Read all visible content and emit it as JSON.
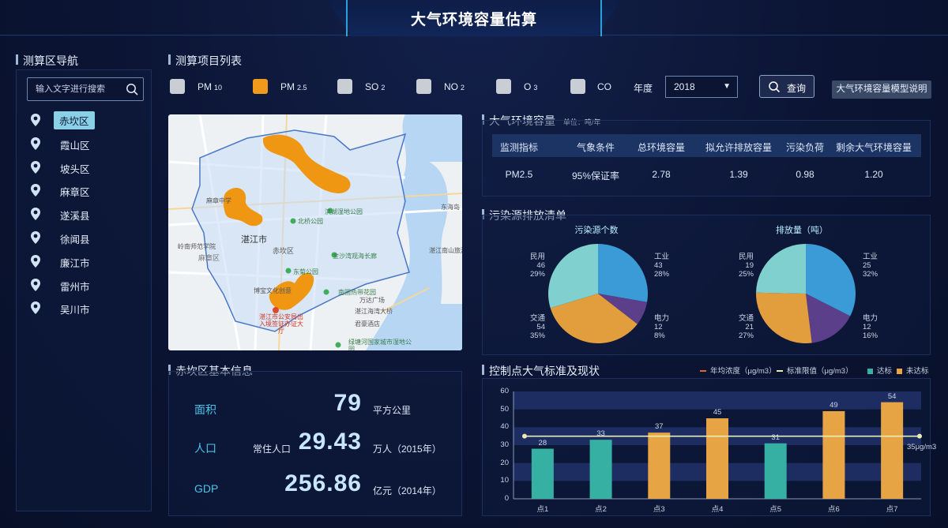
{
  "header": {
    "title": "大气环境容量估算"
  },
  "nav": {
    "title": "测算区导航",
    "search_placeholder": "输入文字进行搜索",
    "items": [
      {
        "label": "赤坎区",
        "active": true
      },
      {
        "label": "霞山区"
      },
      {
        "label": "坡头区"
      },
      {
        "label": "麻章区"
      },
      {
        "label": "遂溪县"
      },
      {
        "label": "徐闻县"
      },
      {
        "label": "廉江市"
      },
      {
        "label": "雷州市"
      },
      {
        "label": "吴川市"
      }
    ]
  },
  "project": {
    "title": "测算项目列表",
    "pollutants": [
      {
        "main": "PM",
        "sub": "10",
        "checked": false
      },
      {
        "main": "PM",
        "sub": "2.5",
        "checked": true
      },
      {
        "main": "SO",
        "sub": "2",
        "checked": false
      },
      {
        "main": "NO",
        "sub": "2",
        "checked": false
      },
      {
        "main": "O",
        "sub": "3",
        "checked": false
      },
      {
        "main": "CO",
        "sub": "",
        "checked": false
      }
    ],
    "year_label": "年度",
    "year_value": "2018",
    "query_label": "查询",
    "model_label": "大气环境容量模型说明"
  },
  "map": {
    "labels": {
      "city": "湛江市",
      "district": "赤坎区",
      "mazhang": "麻章区",
      "park1": "北桥公园",
      "park2": "滨湖湿地公园",
      "park3": "金沙湾观海长廊",
      "park4": "东菊公园",
      "park5": "南国热带花园",
      "mall": "万达广场",
      "bridge": "湛江海湾大桥",
      "hotel": "君豪酒店",
      "center": "湛江市公安局出入境签证办证大厅",
      "culture": "博宝文化创意",
      "green": "绿塘河国家城市湿地公园",
      "road1": "麻章中学",
      "road2": "岭南师范学院",
      "nanshan": "湛江南山旅游学校",
      "donghai": "东海岛"
    }
  },
  "capacity": {
    "title": "大气环境容量",
    "unit": "单位：吨/年",
    "headers": [
      "监测指标",
      "气象条件",
      "总环境容量",
      "拟允许排放容量",
      "污染负荷",
      "剩余大气环境容量"
    ],
    "row": [
      "PM2.5",
      "95%保证率",
      "2.78",
      "1.39",
      "0.98",
      "1.20"
    ]
  },
  "emission": {
    "title": "污染源排放清单",
    "pie1_title": "污染源个数",
    "pie2_title": "排放量（吨）",
    "pie1": [
      {
        "name": "工业",
        "value": 43,
        "pct": "28%",
        "color": "#3a9bd6"
      },
      {
        "name": "电力",
        "value": 12,
        "pct": "8%",
        "color": "#5b3f8a"
      },
      {
        "name": "交通",
        "value": 54,
        "pct": "35%",
        "color": "#e29e3c"
      },
      {
        "name": "民用",
        "value": 46,
        "pct": "29%",
        "color": "#7fd0cf"
      }
    ],
    "pie2": [
      {
        "name": "工业",
        "value": 25,
        "pct": "32%",
        "color": "#3a9bd6"
      },
      {
        "name": "电力",
        "value": 12,
        "pct": "16%",
        "color": "#5b3f8a"
      },
      {
        "name": "交通",
        "value": 21,
        "pct": "27%",
        "color": "#e29e3c"
      },
      {
        "name": "民用",
        "value": 19,
        "pct": "25%",
        "color": "#7fd0cf"
      }
    ]
  },
  "info": {
    "title": "赤坎区基本信息",
    "area_label": "面积",
    "area_value": "79",
    "area_unit": "平方公里",
    "pop_label": "人口",
    "pop_prefix": "常住人口",
    "pop_value": "29.43",
    "pop_unit": "万人（2015年）",
    "gdp_label": "GDP",
    "gdp_value": "256.86",
    "gdp_unit": "亿元（2014年）"
  },
  "control": {
    "title": "控制点大气标准及现状",
    "legend": [
      "年均浓度（μg/m3）",
      "标准限值（μg/m3）",
      "达标",
      "未达标"
    ],
    "standard_label": "35μg/m3"
  },
  "chart_data": {
    "type": "bar",
    "categories": [
      "点1",
      "点2",
      "点3",
      "点4",
      "点5",
      "点6",
      "点7"
    ],
    "values": [
      28,
      33,
      37,
      45,
      31,
      49,
      54
    ],
    "status": [
      "达标",
      "达标",
      "未达标",
      "未达标",
      "达标",
      "未达标",
      "未达标"
    ],
    "standard": 35,
    "ylim": [
      0,
      60
    ],
    "yticks": [
      0,
      10,
      20,
      30,
      40,
      50,
      60
    ],
    "colors": {
      "pass": "#35b0a3",
      "fail": "#e7a444",
      "standard": "#e8edb3",
      "avg": "#e0672a"
    }
  }
}
